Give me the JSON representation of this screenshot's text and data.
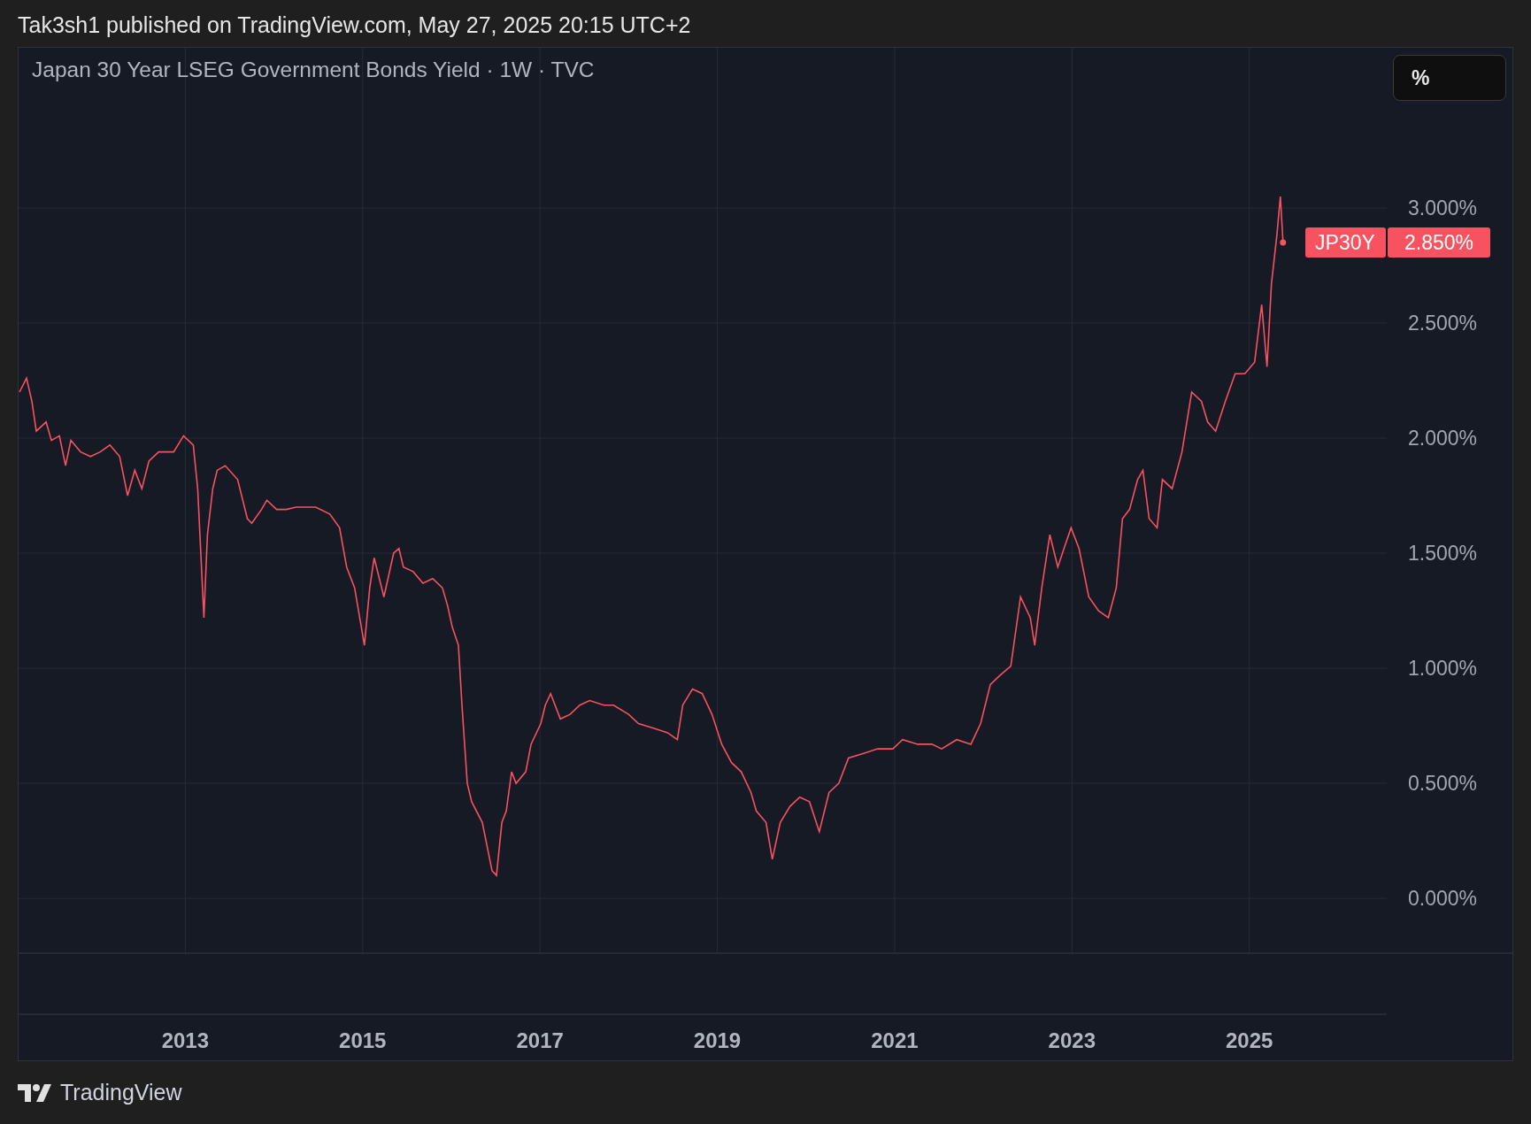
{
  "header": {
    "text": "Tak3sh1 published on TradingView.com, May 27, 2025 20:15 UTC+2"
  },
  "chart": {
    "legend": "Japan 30 Year LSEG Government Bonds Yield · 1W · TVC",
    "unit_button": "%",
    "price_label": {
      "value": "2.850%"
    },
    "chart_data": {
      "type": "line",
      "grid": true,
      "xlim": [
        2011.12,
        2026.55
      ],
      "ylim": [
        -0.238,
        3.696
      ],
      "xticks": [
        {
          "value": 2013,
          "label": "2013"
        },
        {
          "value": 2015,
          "label": "2015"
        },
        {
          "value": 2017,
          "label": "2017"
        },
        {
          "value": 2019,
          "label": "2019"
        },
        {
          "value": 2021,
          "label": "2021"
        },
        {
          "value": 2023,
          "label": "2023"
        },
        {
          "value": 2025,
          "label": "2025"
        }
      ],
      "yticks": [
        {
          "value": 0,
          "label": "0.000%"
        },
        {
          "value": 0.5,
          "label": "0.500%"
        },
        {
          "value": 1,
          "label": "1.000%"
        },
        {
          "value": 1.5,
          "label": "1.500%"
        },
        {
          "value": 2,
          "label": "2.000%"
        },
        {
          "value": 2.5,
          "label": "2.500%"
        },
        {
          "value": 3,
          "label": "3.000%"
        }
      ],
      "x": [
        2011.13,
        2011.21,
        2011.27,
        2011.32,
        2011.43,
        2011.49,
        2011.58,
        2011.65,
        2011.71,
        2011.82,
        2011.93,
        2012.04,
        2012.15,
        2012.26,
        2012.35,
        2012.43,
        2012.51,
        2012.59,
        2012.7,
        2012.87,
        2012.98,
        2013.09,
        2013.14,
        2013.21,
        2013.25,
        2013.31,
        2013.36,
        2013.45,
        2013.59,
        2013.7,
        2013.75,
        2013.86,
        2013.92,
        2014.03,
        2014.14,
        2014.25,
        2014.47,
        2014.63,
        2014.74,
        2014.82,
        2014.91,
        2015.02,
        2015.08,
        2015.13,
        2015.24,
        2015.35,
        2015.41,
        2015.46,
        2015.57,
        2015.68,
        2015.79,
        2015.9,
        2015.96,
        2016.01,
        2016.08,
        2016.12,
        2016.18,
        2016.23,
        2016.35,
        2016.46,
        2016.51,
        2016.57,
        2016.62,
        2016.68,
        2016.73,
        2016.84,
        2016.9,
        2017.01,
        2017.06,
        2017.12,
        2017.23,
        2017.34,
        2017.45,
        2017.56,
        2017.72,
        2017.83,
        2018.0,
        2018.11,
        2018.28,
        2018.44,
        2018.55,
        2018.61,
        2018.72,
        2018.83,
        2018.94,
        2019.05,
        2019.16,
        2019.27,
        2019.38,
        2019.44,
        2019.55,
        2019.62,
        2019.71,
        2019.82,
        2019.93,
        2020.04,
        2020.15,
        2020.26,
        2020.37,
        2020.48,
        2020.65,
        2020.81,
        2020.98,
        2021.09,
        2021.26,
        2021.42,
        2021.53,
        2021.7,
        2021.86,
        2021.97,
        2022.08,
        2022.19,
        2022.31,
        2022.42,
        2022.53,
        2022.58,
        2022.66,
        2022.75,
        2022.84,
        2022.91,
        2022.99,
        2023.08,
        2023.19,
        2023.3,
        2023.41,
        2023.5,
        2023.57,
        2023.65,
        2023.74,
        2023.8,
        2023.87,
        2023.96,
        2024.02,
        2024.13,
        2024.24,
        2024.35,
        2024.46,
        2024.53,
        2024.62,
        2024.73,
        2024.84,
        2024.95,
        2025.06,
        2025.14,
        2025.2,
        2025.25,
        2025.31,
        2025.35,
        2025.38
      ],
      "series": [
        {
          "name": "JP30Y",
          "color": "#f7525f",
          "values": [
            2.2,
            2.26,
            2.16,
            2.03,
            2.07,
            1.99,
            2.01,
            1.88,
            1.99,
            1.94,
            1.92,
            1.94,
            1.97,
            1.92,
            1.75,
            1.86,
            1.78,
            1.9,
            1.94,
            1.94,
            2.01,
            1.97,
            1.78,
            1.22,
            1.58,
            1.78,
            1.86,
            1.88,
            1.82,
            1.65,
            1.63,
            1.69,
            1.73,
            1.69,
            1.69,
            1.7,
            1.7,
            1.67,
            1.61,
            1.44,
            1.35,
            1.1,
            1.35,
            1.48,
            1.31,
            1.5,
            1.52,
            1.44,
            1.42,
            1.37,
            1.39,
            1.35,
            1.27,
            1.18,
            1.1,
            0.84,
            0.5,
            0.42,
            0.33,
            0.12,
            0.1,
            0.33,
            0.38,
            0.55,
            0.5,
            0.55,
            0.67,
            0.76,
            0.84,
            0.89,
            0.78,
            0.8,
            0.84,
            0.86,
            0.84,
            0.84,
            0.8,
            0.76,
            0.74,
            0.72,
            0.69,
            0.84,
            0.91,
            0.89,
            0.8,
            0.67,
            0.59,
            0.55,
            0.46,
            0.38,
            0.33,
            0.17,
            0.33,
            0.4,
            0.44,
            0.42,
            0.29,
            0.46,
            0.5,
            0.61,
            0.63,
            0.65,
            0.65,
            0.69,
            0.67,
            0.67,
            0.65,
            0.69,
            0.67,
            0.76,
            0.93,
            0.97,
            1.01,
            1.31,
            1.22,
            1.1,
            1.35,
            1.58,
            1.44,
            1.52,
            1.61,
            1.52,
            1.31,
            1.25,
            1.22,
            1.35,
            1.65,
            1.69,
            1.82,
            1.86,
            1.65,
            1.61,
            1.82,
            1.78,
            1.94,
            2.2,
            2.16,
            2.07,
            2.03,
            2.16,
            2.28,
            2.28,
            2.33,
            2.58,
            2.31,
            2.67,
            2.88,
            3.05,
            2.85
          ]
        }
      ]
    }
  },
  "footer": {
    "brand": "TradingView"
  }
}
